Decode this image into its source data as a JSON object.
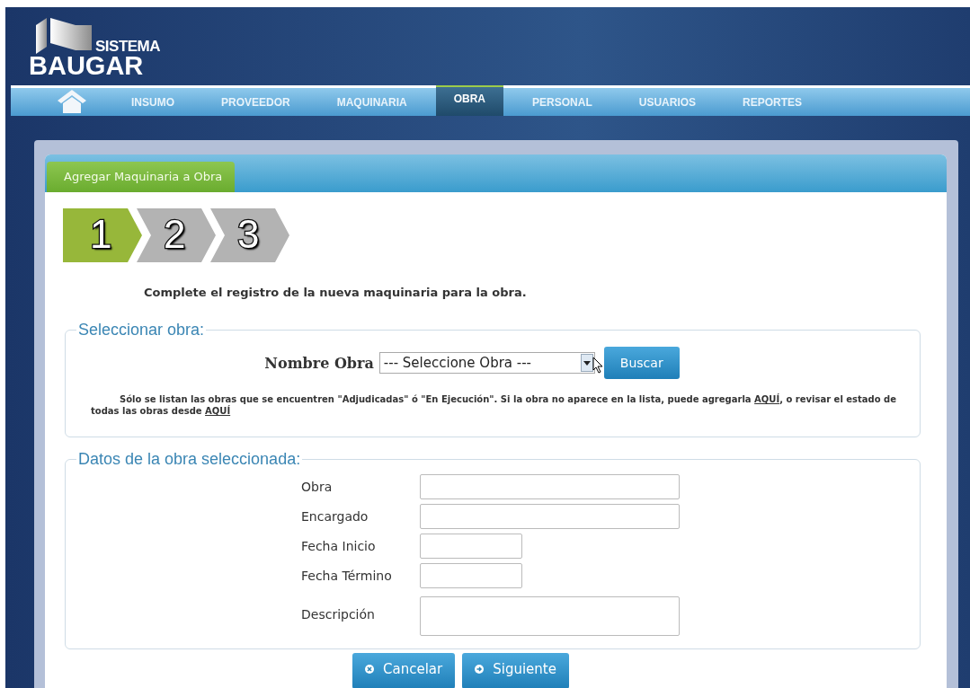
{
  "logo": {
    "small": "SISTEMA",
    "large": "BAUGAR"
  },
  "nav": [
    {
      "label": "INSUMO",
      "selected": false
    },
    {
      "label": "PROVEEDOR",
      "selected": false
    },
    {
      "label": "MAQUINARIA",
      "selected": false
    },
    {
      "label": "OBRA",
      "selected": true
    },
    {
      "label": "PERSONAL",
      "selected": false
    },
    {
      "label": "USUARIOS",
      "selected": false
    },
    {
      "label": "REPORTES",
      "selected": false
    }
  ],
  "panel_tab": "Agregar Maquinaria a Obra",
  "steps": [
    {
      "label": "1",
      "selected": true
    },
    {
      "label": "2",
      "selected": false
    },
    {
      "label": "3",
      "selected": false
    }
  ],
  "intro": "Complete el registro de la nueva maquinaria para la obra.",
  "select_section": {
    "legend": "Seleccionar obra:",
    "label": "Nombre Obra",
    "value": "--- Seleccione Obra ---",
    "button": "Buscar",
    "note": [
      {
        "kind": "text",
        "text": "Sólo se listan las obras que se encuentren \"Adjudicadas\" ó \"En Ejecución\". Si la obra no aparece en la lista, puede agregarla "
      },
      {
        "kind": "link",
        "text": "AQUÍ"
      },
      {
        "kind": "text",
        "text": ", o revisar el estado de todas las obras desde "
      },
      {
        "kind": "link",
        "text": "AQUÍ"
      }
    ]
  },
  "data_section": {
    "legend": "Datos de la obra seleccionada:",
    "fields": [
      {
        "label": "Obra",
        "kind": "wide"
      },
      {
        "label": "Encargado",
        "kind": "wide"
      },
      {
        "label": "Fecha Inicio",
        "kind": "short"
      },
      {
        "label": "Fecha Término",
        "kind": "short"
      },
      {
        "label": "Descripción",
        "kind": "textarea"
      }
    ]
  },
  "buttons": [
    {
      "label": "Cancelar",
      "kind": "cancel"
    },
    {
      "label": "Siguiente",
      "kind": "next"
    }
  ]
}
